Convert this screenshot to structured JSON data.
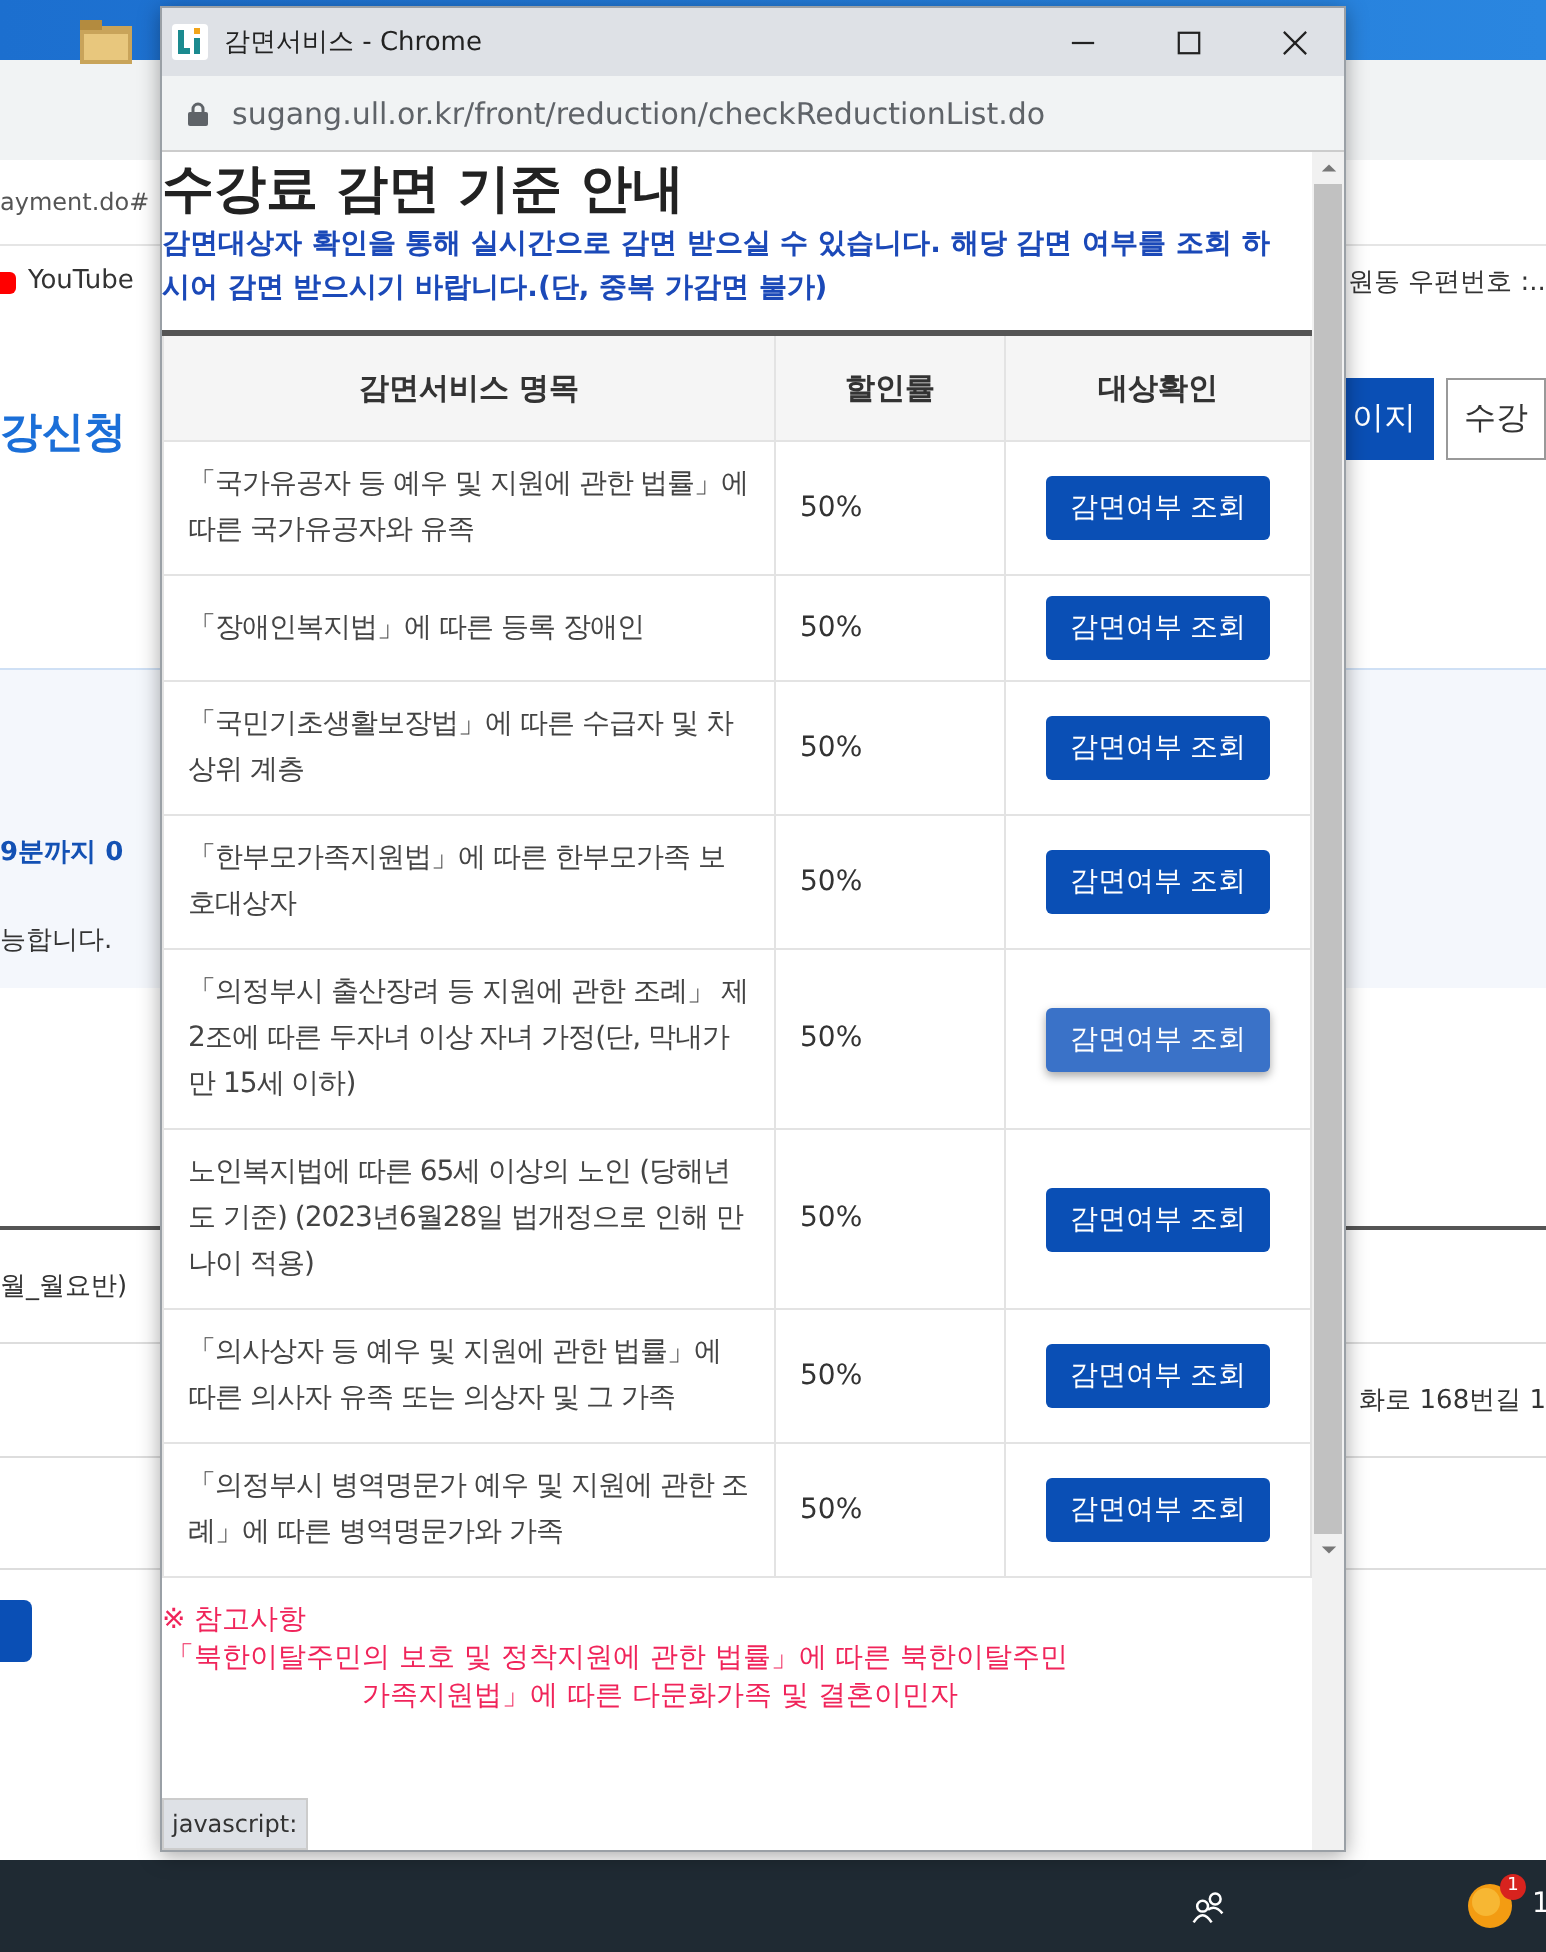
{
  "background_page": {
    "address_fragment": "ayment.do#",
    "bookmark": "YouTube",
    "bookmark_right": "원동 우편번호 :...",
    "site_title": "강신청",
    "header_buttons": [
      {
        "label": "이지",
        "kind": "filled"
      },
      {
        "label": "수강",
        "kind": "outline"
      }
    ],
    "notice_lines": [
      {
        "text": "9분까지 0",
        "kind": "bold"
      },
      {
        "text": "능합니다.",
        "kind": "plain"
      }
    ],
    "list_rows": [
      {
        "left": "월_월요반)",
        "right": ""
      },
      {
        "left": "",
        "right": "화로 168번길 1"
      }
    ]
  },
  "popup": {
    "window_title": "감면서비스 - Chrome",
    "url": "sugang.ull.or.kr/front/reduction/checkReductionList.do",
    "heading": "수강료 감면 기준 안내",
    "subtitle": "감면대상자 확인을 통해 실시간으로 감면 받으실 수 있습니다. 해당 감면 여부를 조회 하시어 감면 받으시기 바랍니다.(단, 중복 가감면 불가)",
    "table": {
      "columns": [
        "감면서비스 명목",
        "할인률",
        "대상확인"
      ],
      "rows": [
        {
          "name": "「국가유공자 등 예우 및 지원에 관한 법률」에 따른 국가유공자와 유족",
          "rate": "50%",
          "button": "감면여부 조회",
          "highlighted": false
        },
        {
          "name": "「장애인복지법」에 따른 등록 장애인",
          "rate": "50%",
          "button": "감면여부 조회",
          "highlighted": false
        },
        {
          "name": "「국민기초생활보장법」에 따른 수급자 및 차상위 계층",
          "rate": "50%",
          "button": "감면여부 조회",
          "highlighted": false
        },
        {
          "name": "「한부모가족지원법」에 따른 한부모가족 보호대상자",
          "rate": "50%",
          "button": "감면여부 조회",
          "highlighted": false
        },
        {
          "name": "「의정부시 출산장려 등 지원에 관한 조례」 제2조에 따른 두자녀 이상 자녀 가정(단, 막내가 만 15세 이하)",
          "rate": "50%",
          "button": "감면여부 조회",
          "highlighted": true
        },
        {
          "name": "노인복지법에 따른 65세 이상의 노인 (당해년도 기준) (2023년6월28일 법개정으로 인해 만 나이 적용)",
          "rate": "50%",
          "button": "감면여부 조회",
          "highlighted": false
        },
        {
          "name": "「의사상자 등 예우 및 지원에 관한 법률」에 따른 의사자 유족 또는 의상자 및 그 가족",
          "rate": "50%",
          "button": "감면여부 조회",
          "highlighted": false
        },
        {
          "name": "「의정부시 병역명문가 예우 및 지원에 관한 조례」에 따른 병역명문가와 가족",
          "rate": "50%",
          "button": "감면여부 조회",
          "highlighted": false
        }
      ]
    },
    "notes_title": "※ 참고사항",
    "notes": [
      "「북한이탈주민의 보호 및 정착지원에 관한 법률」에 따른 북한이탈주민",
      "가족지원법」에 따른 다문화가족 및 결혼이민자"
    ],
    "status_tooltip": "javascript:"
  },
  "taskbar": {
    "badge": "1",
    "clock_fragment": "1"
  }
}
